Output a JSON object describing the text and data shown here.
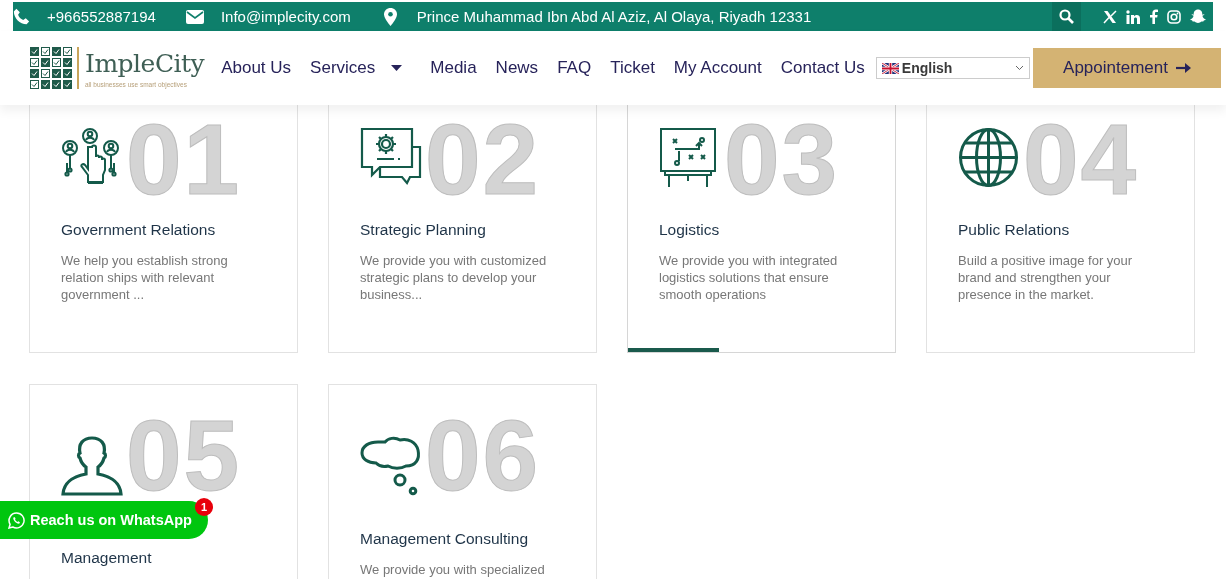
{
  "top_bar": {
    "phone": "+966552887194",
    "email": "Info@implecity.com",
    "address": "Prince Muhammad Ibn Abd Al Aziz, Al Olaya, Riyadh 12331"
  },
  "header": {
    "logo": {
      "name": "ImpleCity",
      "tagline": "all businesses use smart objectives"
    },
    "nav": [
      {
        "label": "About Us",
        "dropdown": false
      },
      {
        "label": "Services",
        "dropdown": true
      },
      {
        "label": "Media",
        "dropdown": false
      },
      {
        "label": "News",
        "dropdown": false
      },
      {
        "label": "FAQ",
        "dropdown": false
      },
      {
        "label": "Ticket",
        "dropdown": false
      },
      {
        "label": "My Account",
        "dropdown": false
      },
      {
        "label": "Contact Us",
        "dropdown": false
      }
    ],
    "language": "English",
    "cta": "Appointement"
  },
  "services": [
    {
      "number": "01",
      "title": "Government Relations",
      "description": "We help you establish strong relation ships with relevant government ...",
      "selected": false
    },
    {
      "number": "02",
      "title": "Strategic Planning",
      "description": "We provide you with customized strategic plans to develop your business...",
      "selected": false
    },
    {
      "number": "03",
      "title": "Logistics",
      "description": "We provide you with integrated logistics solutions that ensure smooth operations",
      "selected": true
    },
    {
      "number": "04",
      "title": "Public Relations",
      "description": "Build a positive image for your brand and strengthen your presence in the market.",
      "selected": false
    },
    {
      "number": "05",
      "title": "Management",
      "selected": false
    },
    {
      "number": "06",
      "title": "Management Consulting",
      "description": "We provide you with specialized",
      "selected": false
    }
  ],
  "whatsapp": {
    "label": "Reach us on WhatsApp",
    "badge": "1"
  }
}
